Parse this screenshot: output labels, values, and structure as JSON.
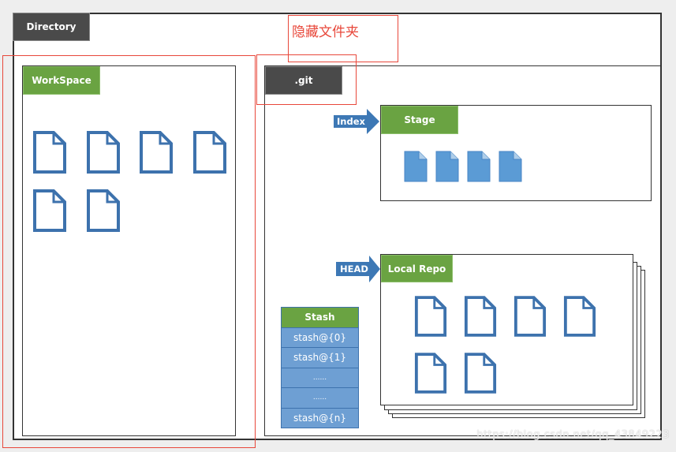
{
  "diagram": {
    "directory": {
      "label": "Directory"
    },
    "hidden_folder_note": "隐藏文件夹",
    "workspace": {
      "label": "WorkSpace",
      "file_count": 6
    },
    "git": {
      "label": ".git",
      "stage": {
        "label": "Stage",
        "pointer": "Index",
        "file_count": 4
      },
      "local_repo": {
        "label": "Local Repo",
        "pointer": "HEAD",
        "file_count": 6
      },
      "stash": {
        "label": "Stash",
        "entries": [
          "stash@{0}",
          "stash@{1}",
          "......",
          "......",
          "stash@{n}"
        ]
      }
    },
    "watermark": "https://blog.csdn.net/qq_43849223"
  },
  "colors": {
    "tab_dark": "#4a4a4a",
    "tab_green": "#6aa342",
    "file_blue": "#3d72ad",
    "file_fill": "#5b9bd5",
    "arrow_blue": "#3d78b5",
    "annotation_red": "#e8473a"
  }
}
